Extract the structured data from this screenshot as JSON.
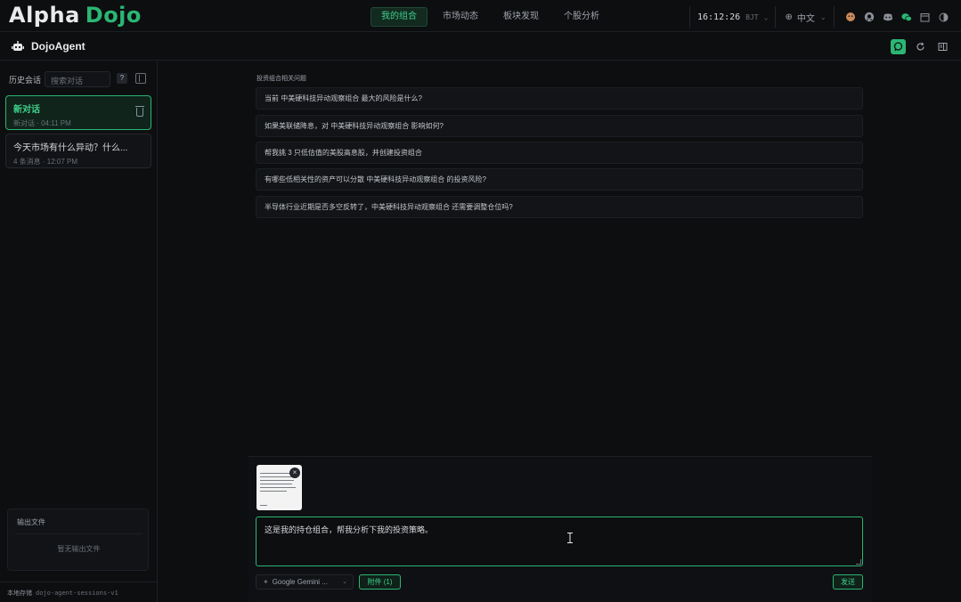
{
  "app": {
    "logo_alpha": "Alpha",
    "logo_dojo": "Dojo"
  },
  "nav": {
    "tabs": [
      {
        "label": "我的组合",
        "active": true
      },
      {
        "label": "市场动态",
        "active": false
      },
      {
        "label": "板块发现",
        "active": false
      },
      {
        "label": "个股分析",
        "active": false
      }
    ]
  },
  "topright": {
    "time": "16:12:26",
    "timezone": "BJT",
    "language": "中文",
    "icons": [
      "avatar-icon",
      "github-icon",
      "discord-icon",
      "wechat-icon",
      "calendar-icon",
      "theme-icon"
    ]
  },
  "agent": {
    "title": "DojoAgent",
    "buttons": [
      "chat-icon",
      "refresh-icon",
      "panel-icon"
    ]
  },
  "sidebar": {
    "history_label": "历史会话",
    "search_placeholder": "搜索对话",
    "help_label": "?",
    "sessions": [
      {
        "title": "新对话",
        "meta": "新对话 · 04:11 PM",
        "active": true
      },
      {
        "title": "今天市场有什么异动？什么...",
        "meta": "4 条消息 · 12:07 PM",
        "active": false
      }
    ],
    "outputs_title": "输出文件",
    "outputs_empty": "暂无输出文件",
    "storage_label": "本地存储",
    "storage_key": "dojo-agent-sessions-v1"
  },
  "main": {
    "suggestions_title": "投资组合相关问题",
    "suggestions": [
      "当前 中美硬科技异动观察组合 最大的风险是什么?",
      "如果美联储降息，对 中美硬科技异动观察组合 影响如何?",
      "帮我挑 3 只低估值的美股高息股，并创建投资组合",
      "有哪些低相关性的资产可以分散 中美硬科技异动观察组合 的投资风险?",
      "半导体行业近期是否多空反转了，中美硬科技异动观察组合 还需要调整仓位吗?"
    ]
  },
  "composer": {
    "input_text": "这是我的持仓组合，帮我分析下我的投资策略。",
    "model": "Google Gemini ...",
    "attach_label": "附件 (1)",
    "send_label": "发送"
  },
  "colors": {
    "accent": "#2bb673",
    "background": "#0d0e10"
  }
}
